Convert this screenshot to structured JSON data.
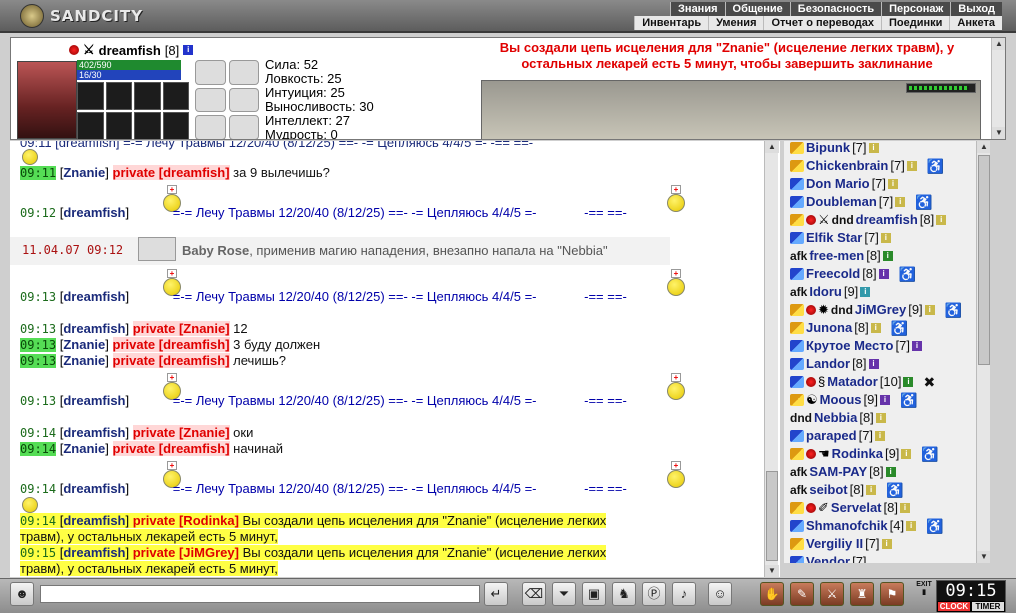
{
  "app": {
    "logo": "SANDCITY"
  },
  "nav": {
    "row1": [
      "Знания",
      "Общение",
      "Безопасность",
      "Персонаж",
      "Выход"
    ],
    "row2": [
      "Инвентарь",
      "Умения",
      "Отчет о переводах",
      "Поединки",
      "Анкета"
    ]
  },
  "character": {
    "name": "dreamfish",
    "level": "[8]",
    "hp": "402/590",
    "mp": "16/30",
    "stats": [
      "Сила: 52",
      "Ловкость: 25",
      "Интуиция: 25",
      "Выносливость: 30",
      "Интеллект: 27",
      "Мудрость: 0"
    ]
  },
  "system_message": "Вы создали цепь исцеления для \"Znanie\" (исцеление легких травм), у остальных лекарей есть 5 минут, чтобы завершить заклинание",
  "chat": {
    "top_partial": "09:11 [dreamfish] =-= Лечу Травмы 12/20/40 (8/12/25) ==- -= Цепляюсь 4/4/5 =- -== ==-",
    "lines": [
      {
        "time": "09:11",
        "nick": "Znanie",
        "private": "private [dreamfish]",
        "text": "за 9 вылечишь?"
      },
      {
        "time": "09:12",
        "nick": "dreamfish",
        "heal": "=-= Лечу Травмы 12/20/40 (8/12/25) ==- -= Цепляюсь 4/4/5 =-",
        "tail": "-== ==-"
      },
      {
        "time": "09:13",
        "nick": "dreamfish",
        "heal": "=-= Лечу Травмы 12/20/40 (8/12/25) ==- -= Цепляюсь 4/4/5 =-",
        "tail": "-== ==-"
      },
      {
        "time": "09:13",
        "nick": "dreamfish",
        "private": "private [Znanie]",
        "text": "12"
      },
      {
        "time": "09:13",
        "nick": "Znanie",
        "private": "private [dreamfish]",
        "text": "3 буду должен"
      },
      {
        "time": "09:13",
        "nick": "Znanie",
        "private": "private [dreamfish]",
        "text": "лечишь?"
      },
      {
        "time": "09:13",
        "nick": "dreamfish",
        "heal": "=-= Лечу Травмы 12/20/40 (8/12/25) ==- -= Цепляюсь 4/4/5 =-",
        "tail": "-== ==-"
      },
      {
        "time": "09:14",
        "nick": "dreamfish",
        "private": "private [Znanie]",
        "text": "оки"
      },
      {
        "time": "09:14",
        "nick": "Znanie",
        "private": "private [dreamfish]",
        "text": "начинай"
      },
      {
        "time": "09:14",
        "nick": "dreamfish",
        "heal": "=-= Лечу Травмы 12/20/40 (8/12/25) ==- -= Цепляюсь 4/4/5 =-",
        "tail": "-== ==-"
      },
      {
        "time": "09:14",
        "nick": "dreamfish",
        "private": "private [Rodinka]",
        "text": "Вы создали цепь исцеления для \"Znanie\" (исцеление легких",
        "cont": "травм), у остальных лекарей есть 5 минут,"
      },
      {
        "time": "09:15",
        "nick": "dreamfish",
        "private": "private [JiMGrey]",
        "text": "Вы создали цепь исцеления для \"Znanie\" (исцеление легких",
        "cont": "травм), у остальных лекарей есть 5 минут,"
      }
    ],
    "attack": {
      "date": "11.04.07",
      "time": "09:12",
      "name": "Baby Rose",
      "text": ", применив магию нападения, внезапно напала на \"Nebbia\""
    }
  },
  "users": [
    {
      "name": "Bipunk",
      "level": "[7]"
    },
    {
      "name": "Chickenbrain",
      "level": "[7]"
    },
    {
      "name": "Don Mario",
      "level": "[7]"
    },
    {
      "name": "Doubleman",
      "level": "[7]"
    },
    {
      "tag": "dnd",
      "name": "dreamfish",
      "level": "[8]"
    },
    {
      "name": "Elfik Star",
      "level": "[7]"
    },
    {
      "tag": "afk",
      "name": "free-men",
      "level": "[8]"
    },
    {
      "name": "Freecold",
      "level": "[8]"
    },
    {
      "tag": "afk",
      "name": "Idoru",
      "level": "[9]"
    },
    {
      "tag": "dnd",
      "name": "JiMGrey",
      "level": "[9]"
    },
    {
      "name": "Junona",
      "level": "[8]"
    },
    {
      "name": "Крутое Местo",
      "level": "[7]"
    },
    {
      "name": "Landor",
      "level": "[8]"
    },
    {
      "name": "Matador",
      "level": "[10]"
    },
    {
      "name": "Moous",
      "level": "[9]"
    },
    {
      "tag": "dnd",
      "name": "Nebbia",
      "level": "[8]"
    },
    {
      "name": "paraped",
      "level": "[7]"
    },
    {
      "name": "Rodinka",
      "level": "[9]"
    },
    {
      "tag": "afk",
      "name": "SAM-PAY",
      "level": "[8]"
    },
    {
      "tag": "afk",
      "name": "seibot",
      "level": "[8]"
    },
    {
      "name": "Servelat",
      "level": "[8]"
    },
    {
      "name": "Shmanofchik",
      "level": "[4]"
    },
    {
      "name": "Vergiliy II",
      "level": "[7]"
    },
    {
      "name": "Vendor",
      "level": "[7]"
    }
  ],
  "footer": {
    "clock": "09:15",
    "clock_label": "CLOCK",
    "timer_label": "TIMER",
    "exit_label": "EXIT"
  }
}
